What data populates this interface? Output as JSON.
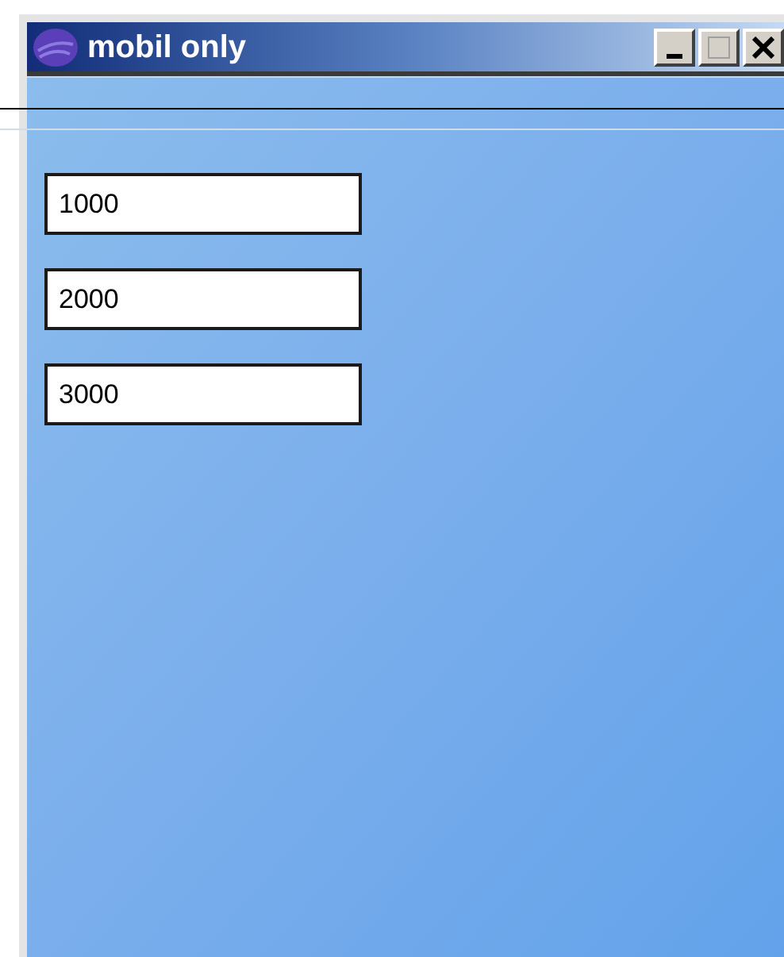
{
  "window": {
    "title": "mobil only"
  },
  "fields": [
    {
      "value": "1000"
    },
    {
      "value": "2000"
    },
    {
      "value": "3000"
    }
  ]
}
